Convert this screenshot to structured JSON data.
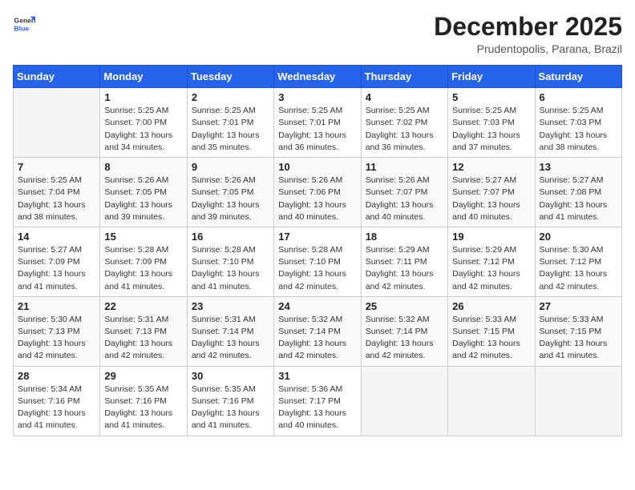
{
  "logo": {
    "general": "General",
    "blue": "Blue"
  },
  "header": {
    "month": "December 2025",
    "location": "Prudentopolis, Parana, Brazil"
  },
  "weekdays": [
    "Sunday",
    "Monday",
    "Tuesday",
    "Wednesday",
    "Thursday",
    "Friday",
    "Saturday"
  ],
  "weeks": [
    [
      {
        "day": "",
        "info": ""
      },
      {
        "day": "1",
        "info": "Sunrise: 5:25 AM\nSunset: 7:00 PM\nDaylight: 13 hours\nand 34 minutes."
      },
      {
        "day": "2",
        "info": "Sunrise: 5:25 AM\nSunset: 7:01 PM\nDaylight: 13 hours\nand 35 minutes."
      },
      {
        "day": "3",
        "info": "Sunrise: 5:25 AM\nSunset: 7:01 PM\nDaylight: 13 hours\nand 36 minutes."
      },
      {
        "day": "4",
        "info": "Sunrise: 5:25 AM\nSunset: 7:02 PM\nDaylight: 13 hours\nand 36 minutes."
      },
      {
        "day": "5",
        "info": "Sunrise: 5:25 AM\nSunset: 7:03 PM\nDaylight: 13 hours\nand 37 minutes."
      },
      {
        "day": "6",
        "info": "Sunrise: 5:25 AM\nSunset: 7:03 PM\nDaylight: 13 hours\nand 38 minutes."
      }
    ],
    [
      {
        "day": "7",
        "info": "Sunrise: 5:25 AM\nSunset: 7:04 PM\nDaylight: 13 hours\nand 38 minutes."
      },
      {
        "day": "8",
        "info": "Sunrise: 5:26 AM\nSunset: 7:05 PM\nDaylight: 13 hours\nand 39 minutes."
      },
      {
        "day": "9",
        "info": "Sunrise: 5:26 AM\nSunset: 7:05 PM\nDaylight: 13 hours\nand 39 minutes."
      },
      {
        "day": "10",
        "info": "Sunrise: 5:26 AM\nSunset: 7:06 PM\nDaylight: 13 hours\nand 40 minutes."
      },
      {
        "day": "11",
        "info": "Sunrise: 5:26 AM\nSunset: 7:07 PM\nDaylight: 13 hours\nand 40 minutes."
      },
      {
        "day": "12",
        "info": "Sunrise: 5:27 AM\nSunset: 7:07 PM\nDaylight: 13 hours\nand 40 minutes."
      },
      {
        "day": "13",
        "info": "Sunrise: 5:27 AM\nSunset: 7:08 PM\nDaylight: 13 hours\nand 41 minutes."
      }
    ],
    [
      {
        "day": "14",
        "info": "Sunrise: 5:27 AM\nSunset: 7:09 PM\nDaylight: 13 hours\nand 41 minutes."
      },
      {
        "day": "15",
        "info": "Sunrise: 5:28 AM\nSunset: 7:09 PM\nDaylight: 13 hours\nand 41 minutes."
      },
      {
        "day": "16",
        "info": "Sunrise: 5:28 AM\nSunset: 7:10 PM\nDaylight: 13 hours\nand 41 minutes."
      },
      {
        "day": "17",
        "info": "Sunrise: 5:28 AM\nSunset: 7:10 PM\nDaylight: 13 hours\nand 42 minutes."
      },
      {
        "day": "18",
        "info": "Sunrise: 5:29 AM\nSunset: 7:11 PM\nDaylight: 13 hours\nand 42 minutes."
      },
      {
        "day": "19",
        "info": "Sunrise: 5:29 AM\nSunset: 7:12 PM\nDaylight: 13 hours\nand 42 minutes."
      },
      {
        "day": "20",
        "info": "Sunrise: 5:30 AM\nSunset: 7:12 PM\nDaylight: 13 hours\nand 42 minutes."
      }
    ],
    [
      {
        "day": "21",
        "info": "Sunrise: 5:30 AM\nSunset: 7:13 PM\nDaylight: 13 hours\nand 42 minutes."
      },
      {
        "day": "22",
        "info": "Sunrise: 5:31 AM\nSunset: 7:13 PM\nDaylight: 13 hours\nand 42 minutes."
      },
      {
        "day": "23",
        "info": "Sunrise: 5:31 AM\nSunset: 7:14 PM\nDaylight: 13 hours\nand 42 minutes."
      },
      {
        "day": "24",
        "info": "Sunrise: 5:32 AM\nSunset: 7:14 PM\nDaylight: 13 hours\nand 42 minutes."
      },
      {
        "day": "25",
        "info": "Sunrise: 5:32 AM\nSunset: 7:14 PM\nDaylight: 13 hours\nand 42 minutes."
      },
      {
        "day": "26",
        "info": "Sunrise: 5:33 AM\nSunset: 7:15 PM\nDaylight: 13 hours\nand 42 minutes."
      },
      {
        "day": "27",
        "info": "Sunrise: 5:33 AM\nSunset: 7:15 PM\nDaylight: 13 hours\nand 41 minutes."
      }
    ],
    [
      {
        "day": "28",
        "info": "Sunrise: 5:34 AM\nSunset: 7:16 PM\nDaylight: 13 hours\nand 41 minutes."
      },
      {
        "day": "29",
        "info": "Sunrise: 5:35 AM\nSunset: 7:16 PM\nDaylight: 13 hours\nand 41 minutes."
      },
      {
        "day": "30",
        "info": "Sunrise: 5:35 AM\nSunset: 7:16 PM\nDaylight: 13 hours\nand 41 minutes."
      },
      {
        "day": "31",
        "info": "Sunrise: 5:36 AM\nSunset: 7:17 PM\nDaylight: 13 hours\nand 40 minutes."
      },
      {
        "day": "",
        "info": ""
      },
      {
        "day": "",
        "info": ""
      },
      {
        "day": "",
        "info": ""
      }
    ]
  ]
}
